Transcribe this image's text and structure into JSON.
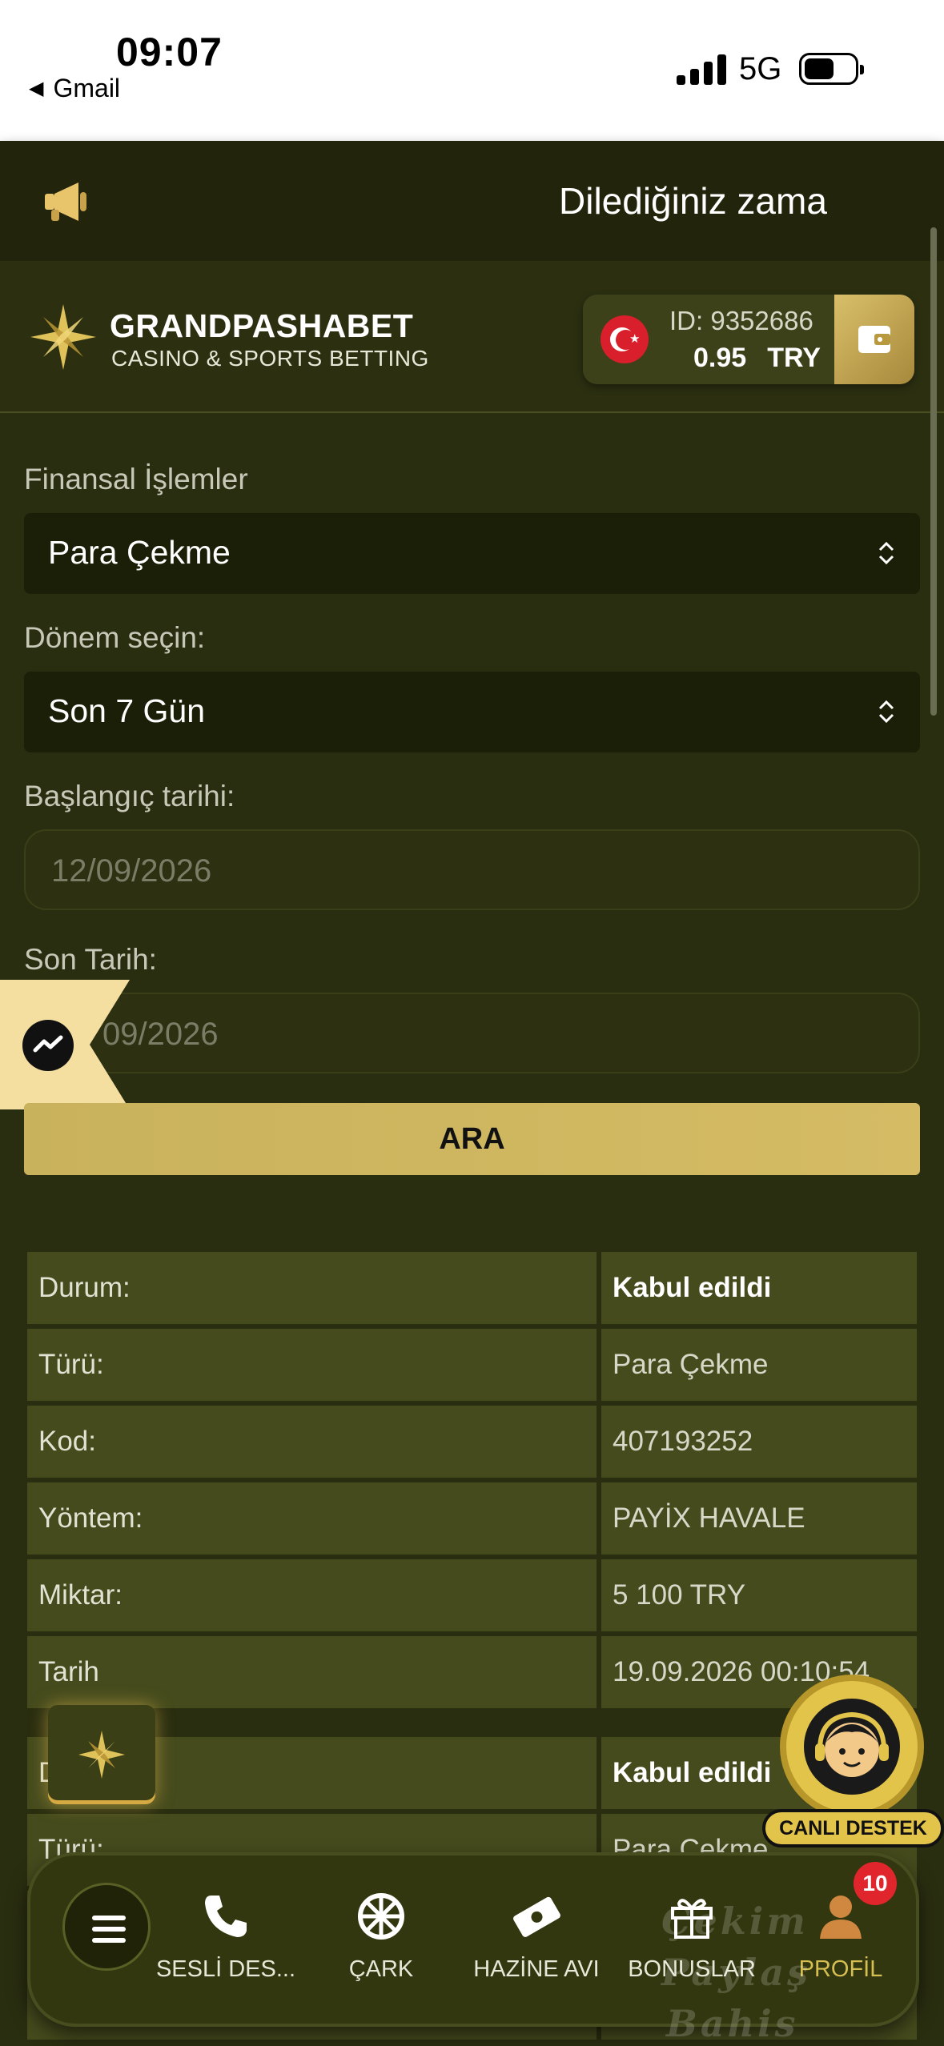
{
  "status_bar": {
    "time": "09:07",
    "back_app": "Gmail",
    "network": "5G"
  },
  "announcement": {
    "text": "Dilediğiniz zama",
    "icon": "megaphone-icon"
  },
  "header": {
    "brand_name": "GRANDPASHABET",
    "brand_tagline": "CASINO & SPORTS BETTING",
    "account_id": "ID: 9352686",
    "balance_amount": "0.95",
    "balance_currency": "TRY"
  },
  "form": {
    "transactions_label": "Finansal İşlemler",
    "transactions_value": "Para Çekme",
    "period_label": "Dönem seçin:",
    "period_value": "Son 7 Gün",
    "start_label": "Başlangıç tarihi:",
    "start_value": "12/09/2026",
    "end_label": "Son Tarih:",
    "end_value": "09/2026",
    "search_button": "ARA"
  },
  "results": [
    {
      "rows": [
        {
          "key": "Durum:",
          "value": "Kabul edildi",
          "bold": true
        },
        {
          "key": "Türü:",
          "value": "Para Çekme"
        },
        {
          "key": "Kod:",
          "value": "407193252"
        },
        {
          "key": "Yöntem:",
          "value": "PAYİX HAVALE"
        },
        {
          "key": "Miktar:",
          "value": "5 100 TRY"
        },
        {
          "key": "Tarih",
          "value": "19.09.2026 00:10:54"
        }
      ]
    },
    {
      "rows": [
        {
          "key": "D",
          "value": "Kabul edildi",
          "bold": true
        },
        {
          "key": "Türü:",
          "value": "Para Çekme"
        },
        {
          "key": "",
          "value": ""
        },
        {
          "key": "Yö",
          "value": ""
        }
      ]
    }
  ],
  "support": {
    "label": "CANLI DESTEK"
  },
  "bottom_nav": {
    "items": [
      {
        "label": "SESLİ DES...",
        "icon": "phone-icon"
      },
      {
        "label": "ÇARK",
        "icon": "wheel-icon"
      },
      {
        "label": "HAZİNE AVI",
        "icon": "treasure-ticket-icon"
      },
      {
        "label": "BONUSLAR",
        "icon": "gift-icon"
      },
      {
        "label": "PROFİL",
        "icon": "user-icon"
      }
    ],
    "badge_count": "10"
  },
  "watermark": {
    "line1": "Çekim Paylaş",
    "line2": "Bahis Forum"
  },
  "colors": {
    "page_bg": "#2a2e10",
    "gold": "#d4bb64",
    "table_cell": "#464b1d",
    "badge": "#e0252c"
  }
}
